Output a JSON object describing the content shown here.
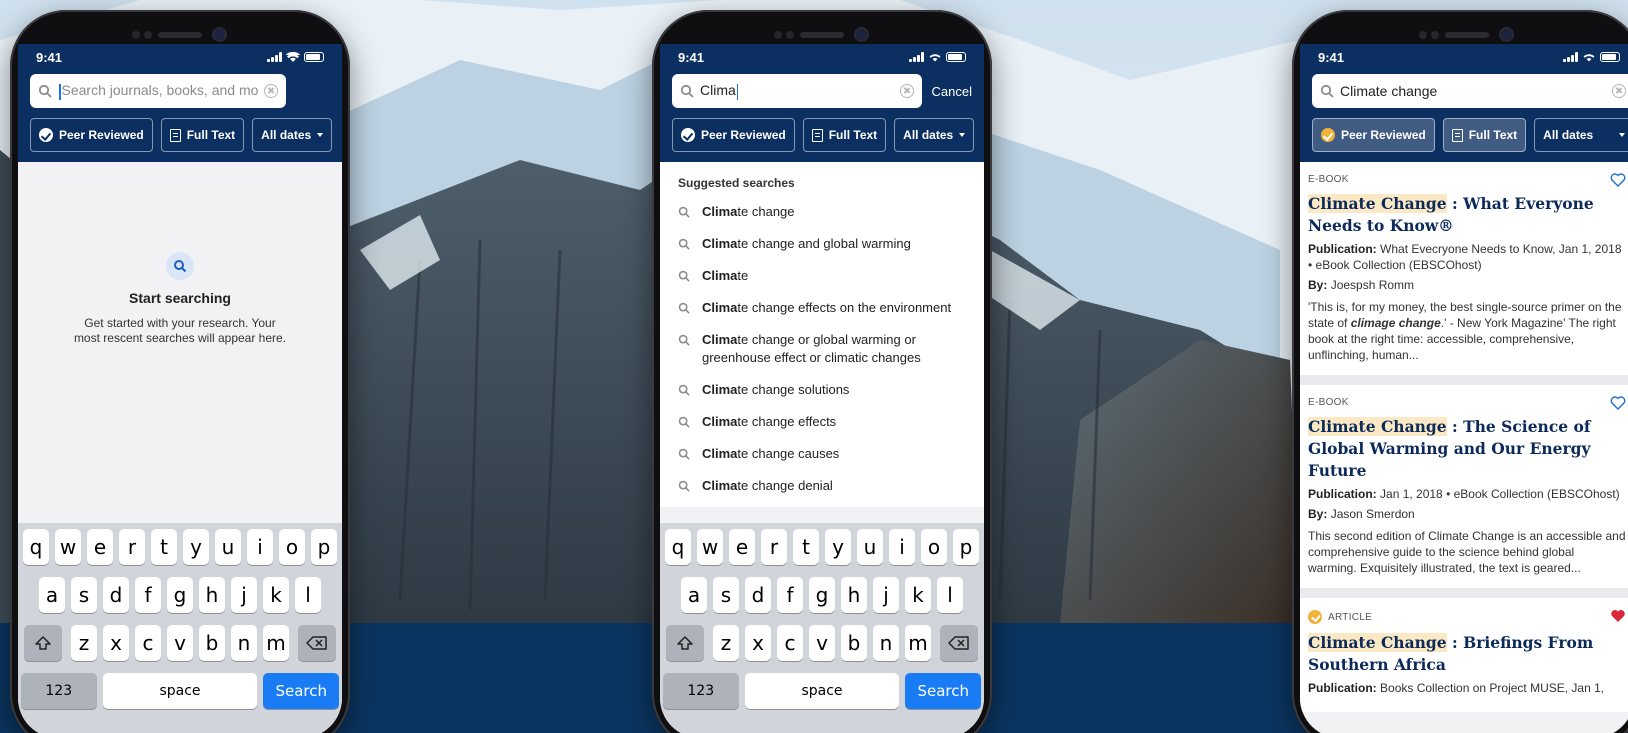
{
  "colors": {
    "header": "#0c2f61",
    "accent": "#1a7cf5",
    "highlight": "#fbe9c5",
    "favorite": "#d9293a",
    "badge": "#f0b23b"
  },
  "status_time": "9:41",
  "filters": {
    "peer_reviewed": "Peer Reviewed",
    "full_text": "Full Text",
    "dates": "All dates"
  },
  "phone1": {
    "search_placeholder": "Search journals, books, and more",
    "empty_title": "Start searching",
    "empty_text": "Get started with your research. Your most rescent searches will appear here."
  },
  "phone2": {
    "query": "Clima",
    "cancel": "Cancel",
    "suggestions_title": "Suggested searches",
    "suggestions": [
      {
        "match": "Clima",
        "rest": "te change"
      },
      {
        "match": "Clima",
        "rest": "te change and global warming"
      },
      {
        "match": "Clima",
        "rest": "te"
      },
      {
        "match": "Clima",
        "rest": "te change effects on the environment"
      },
      {
        "match": "Clima",
        "rest": "te change or global warming or greenhouse effect or climatic changes"
      },
      {
        "match": "Clima",
        "rest": "te change solutions"
      },
      {
        "match": "Clima",
        "rest": "te change effects"
      },
      {
        "match": "Clima",
        "rest": "te change causes"
      },
      {
        "match": "Clima",
        "rest": "te change denial"
      }
    ]
  },
  "keyboard": {
    "row1": [
      "q",
      "w",
      "e",
      "r",
      "t",
      "y",
      "u",
      "i",
      "o",
      "p"
    ],
    "row2": [
      "a",
      "s",
      "d",
      "f",
      "g",
      "h",
      "j",
      "k",
      "l"
    ],
    "row3": [
      "z",
      "x",
      "c",
      "v",
      "b",
      "n",
      "m"
    ],
    "numbers": "123",
    "space": "space",
    "go": "Search",
    "shift_icon": "shift-icon",
    "delete_icon": "backspace-icon"
  },
  "phone3": {
    "query": "Climate change",
    "results": [
      {
        "type": "E-BOOK",
        "title_hl": "Climate Change",
        "title_rest": " : What Everyone Needs to Know®",
        "pub_label": "Publication:",
        "pub": "What Evecryone Needs to Know, Jan 1, 2018 • eBook Collection (EBSCOhost)",
        "by_label": "By:",
        "by": "Joespsh Romm",
        "abstract_a": "'This is, for my money, the best single-source primer on the state of ",
        "abstract_em": "climage change",
        "abstract_b": ".' - New York Magazine' The right book at the right time: accessible, comprehensive, unflinching, human...",
        "favorite": false
      },
      {
        "type": "E-BOOK",
        "title_hl": "Climate Change",
        "title_rest": " : The Science of Global Warming and Our Energy Future",
        "pub_label": "Publication:",
        "pub": "Jan 1, 2018 • eBook Collection (EBSCOhost)",
        "by_label": "By:",
        "by": "Jason Smerdon",
        "abstract": "This second edition of Climate Change is an accessible and comprehensive guide to the science behind global warming. Exquisitely illustrated, the text is geared...",
        "favorite": false
      },
      {
        "type": "ARTICLE",
        "title_hl": "Climate Change",
        "title_rest": " : Briefings From Southern Africa",
        "pub_label": "Publication:",
        "pub": "Books Collection on Project MUSE, Jan 1,",
        "favorite": true
      }
    ]
  }
}
